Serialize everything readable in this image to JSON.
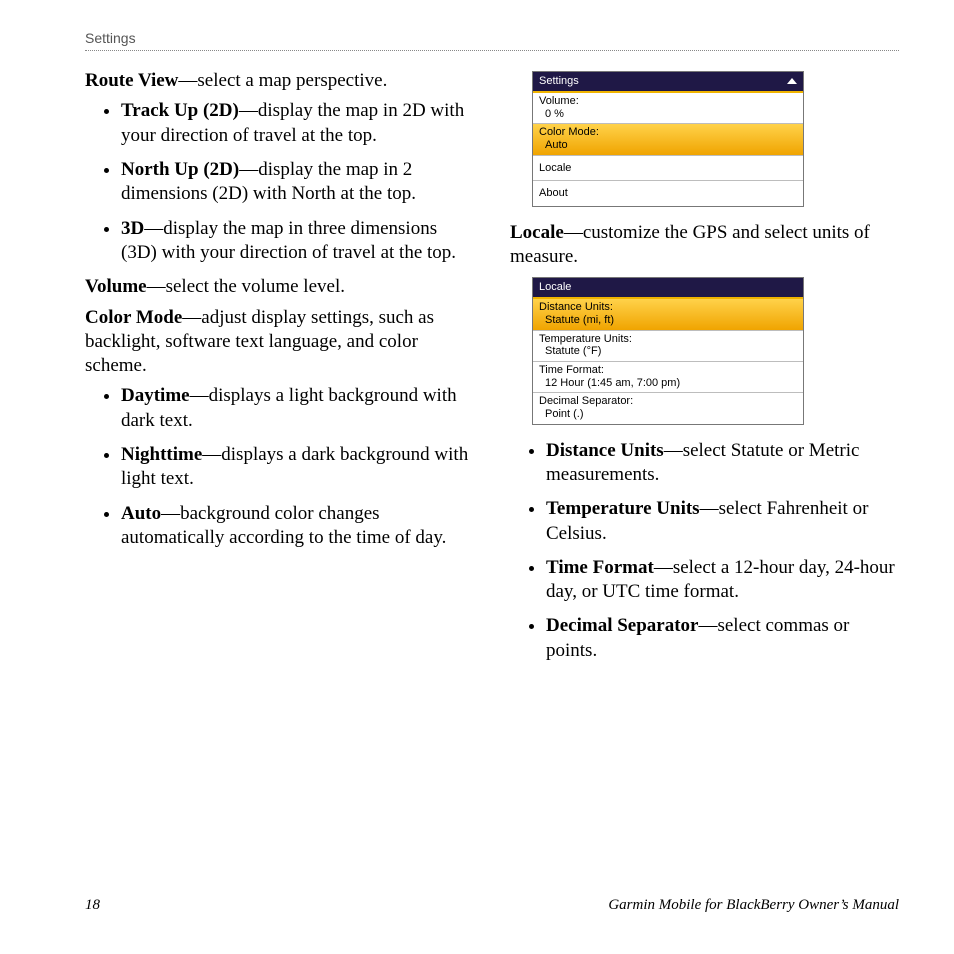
{
  "running_head": "Settings",
  "left": {
    "route_view_term": "Route View",
    "route_view_desc": "—select a map perspective.",
    "rv_items": [
      {
        "term": "Track Up (2D)",
        "desc": "—display the map in 2D with your direction of travel at the top."
      },
      {
        "term": "North Up (2D)",
        "desc": "—display the map in 2 dimensions (2D) with North at the top."
      },
      {
        "term": "3D",
        "desc": "—display the map in three dimensions (3D) with your direction of travel at the top."
      }
    ],
    "volume_term": "Volume",
    "volume_desc": "—select the volume level.",
    "color_mode_term": "Color Mode",
    "color_mode_desc": "—adjust display settings, such as backlight, software text language, and color scheme.",
    "cm_items": [
      {
        "term": "Daytime",
        "desc": "—displays a light background with dark text."
      },
      {
        "term": "Nighttime",
        "desc": "—displays a dark background with light text."
      },
      {
        "term": "Auto",
        "desc": "—background color changes automatically according to the time of day."
      }
    ]
  },
  "right": {
    "settings_shot": {
      "title": "Settings",
      "volume_label": "Volume:",
      "volume_value": "0 %",
      "color_mode_label": "Color Mode:",
      "color_mode_value": "Auto",
      "locale_label": "Locale",
      "about_label": "About"
    },
    "locale_term": "Locale",
    "locale_desc": "—customize the GPS and select units of measure.",
    "locale_shot": {
      "title": "Locale",
      "distance_label": "Distance Units:",
      "distance_value": "Statute (mi, ft)",
      "temperature_label": "Temperature Units:",
      "temperature_value": "Statute (°F)",
      "time_label": "Time Format:",
      "time_value": "12 Hour (1:45 am, 7:00 pm)",
      "decimal_label": "Decimal Separator:",
      "decimal_value": "Point (.)"
    },
    "loc_items": [
      {
        "term": "Distance Units",
        "desc": "—select Statute or Metric measurements."
      },
      {
        "term": "Temperature Units",
        "desc": "—select Fahrenheit or Celsius."
      },
      {
        "term": "Time Format",
        "desc": "—select a 12-hour day, 24-hour day, or UTC time format."
      },
      {
        "term": "Decimal Separator",
        "desc": "—select commas or points."
      }
    ]
  },
  "footer": {
    "page_no": "18",
    "doc_title": "Garmin Mobile for BlackBerry Owner’s Manual"
  }
}
